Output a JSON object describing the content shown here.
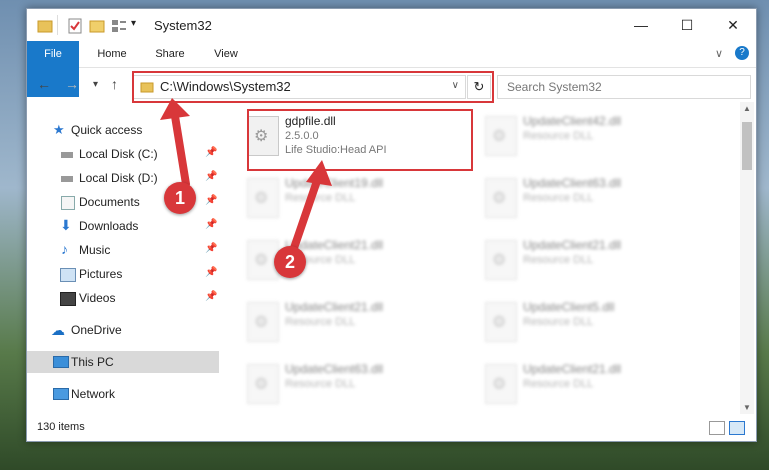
{
  "window": {
    "title": "System32"
  },
  "ribbon": {
    "tabs": [
      "File",
      "Home",
      "Share",
      "View"
    ]
  },
  "address": {
    "path": "C:\\Windows\\System32",
    "search_placeholder": "Search System32"
  },
  "nav": [
    {
      "label": "Quick access",
      "icon": "star-icon",
      "pinned": false
    },
    {
      "label": "Local Disk (C:)",
      "icon": "drive-icon",
      "pinned": true
    },
    {
      "label": "Local Disk (D:)",
      "icon": "drive-icon",
      "pinned": true
    },
    {
      "label": "Documents",
      "icon": "documents-icon",
      "pinned": true
    },
    {
      "label": "Downloads",
      "icon": "download-icon",
      "pinned": true
    },
    {
      "label": "Music",
      "icon": "music-icon",
      "pinned": true
    },
    {
      "label": "Pictures",
      "icon": "pictures-icon",
      "pinned": true
    },
    {
      "label": "Videos",
      "icon": "videos-icon",
      "pinned": true
    },
    {
      "label": "OneDrive",
      "icon": "cloud-icon",
      "pinned": false
    },
    {
      "label": "This PC",
      "icon": "pc-icon",
      "pinned": false
    },
    {
      "label": "Network",
      "icon": "network-icon",
      "pinned": false
    }
  ],
  "files": [
    {
      "name": "gdpfile.dll",
      "line1": "2.5.0.0",
      "line2": "Life Studio:Head API"
    },
    {
      "name": "UpdateClient42.dll",
      "line1": "Resource DLL",
      "line2": ""
    },
    {
      "name": "UpdateClient19.dll",
      "line1": "Resource DLL",
      "line2": ""
    },
    {
      "name": "UpdateClient63.dll",
      "line1": "Resource DLL",
      "line2": ""
    },
    {
      "name": "UpdateClient21.dll",
      "line1": "Resource DLL",
      "line2": ""
    },
    {
      "name": "UpdateClient21.dll",
      "line1": "Resource DLL",
      "line2": ""
    },
    {
      "name": "UpdateClient21.dll",
      "line1": "Resource DLL",
      "line2": ""
    },
    {
      "name": "UpdateClient5.dll",
      "line1": "Resource DLL",
      "line2": ""
    },
    {
      "name": "UpdateClient63.dll",
      "line1": "Resource DLL",
      "line2": ""
    },
    {
      "name": "UpdateClient21.dll",
      "line1": "Resource DLL",
      "line2": ""
    }
  ],
  "status": {
    "count": "130 items"
  },
  "markers": [
    "1",
    "2"
  ],
  "colors": {
    "accent": "#1979ca",
    "highlight": "#d8373a"
  }
}
